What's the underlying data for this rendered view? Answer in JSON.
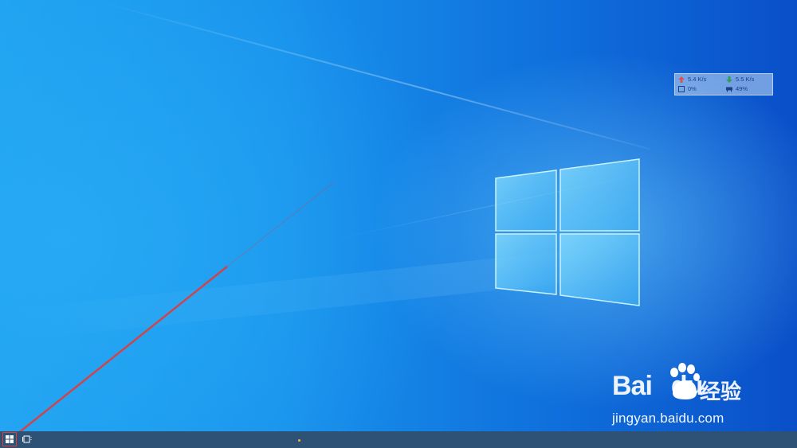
{
  "net_monitor": {
    "upload": "5.4 K/s",
    "download": "5.5 K/s",
    "cpu": "0%",
    "memory": "49%",
    "icons": {
      "upload": "arrow-up-icon",
      "download": "arrow-down-icon",
      "cpu": "cpu-icon",
      "memory": "memory-icon"
    },
    "colors": {
      "upload": "#d9534f",
      "download": "#2e9e5b",
      "text": "#1d3f86"
    }
  },
  "watermark": {
    "brand": "Bai",
    "brand_suffix": "du",
    "chinese": "经验",
    "url": "jingyan.baidu.com"
  },
  "taskbar": {
    "start_icon": "windows-start-icon",
    "taskview_icon": "task-view-icon",
    "highlight_color": "#e23b3b"
  },
  "annotation": {
    "arrow_color": "#e23b3b"
  }
}
